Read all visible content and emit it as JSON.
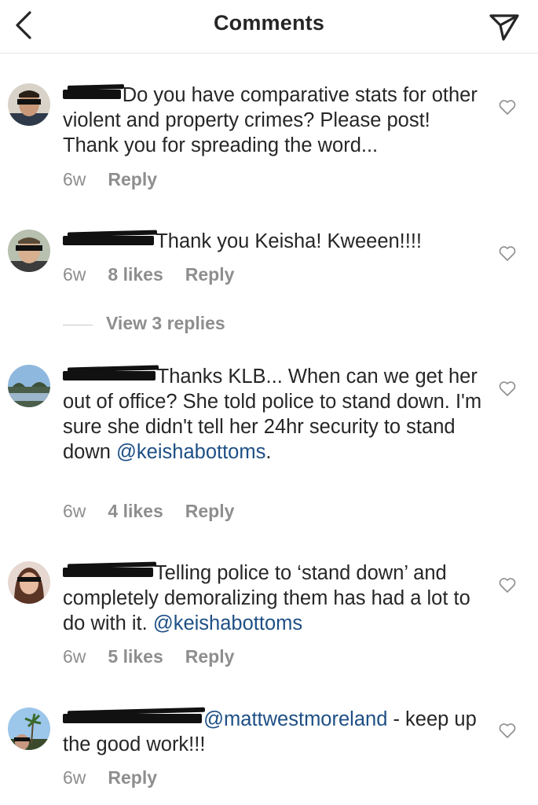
{
  "header": {
    "title": "Comments"
  },
  "comments": [
    {
      "username_redacted": "flintedi",
      "text": "Do you have comparative stats for other violent and property crimes? Please post! Thank you for spreading the word...",
      "time": "6w",
      "likes": "",
      "reply": "Reply"
    },
    {
      "username_redacted": "tracestlion",
      "text": "Thank you Keisha!  Kweeen!!!!",
      "time": "6w",
      "likes": "8 likes",
      "reply": "Reply"
    },
    {
      "username_redacted": "marjoyentl",
      "text_before": "Thanks KLB... When can we get her out of office? She told police to stand down. I'm sure she didn't tell her 24hr security to stand down ",
      "mention": "@keishabottoms",
      "text_after": ".",
      "time": "6w",
      "likes": "4 likes",
      "reply": "Reply"
    },
    {
      "username_redacted": "lisaannlo7",
      "text_before": "Telling police to ‘stand down’ and completely demoralizing them has had a lot to do with it. ",
      "mention": "@keishabottoms",
      "time": "6w",
      "likes": "5 likes",
      "reply": "Reply"
    },
    {
      "username_redacted": "kristinacdmentz",
      "mention": "@mattwestmoreland",
      "text_after": " - keep up the good work!!!",
      "time": "6w",
      "likes": "",
      "reply": "Reply"
    }
  ],
  "view_replies": "View 3 replies",
  "icons": [
    "chevron-left-icon",
    "paper-plane-icon",
    "heart-outline-icon"
  ],
  "colors": {
    "mention": "#1d4f85",
    "meta": "#8e8e8e",
    "text": "#262626"
  }
}
